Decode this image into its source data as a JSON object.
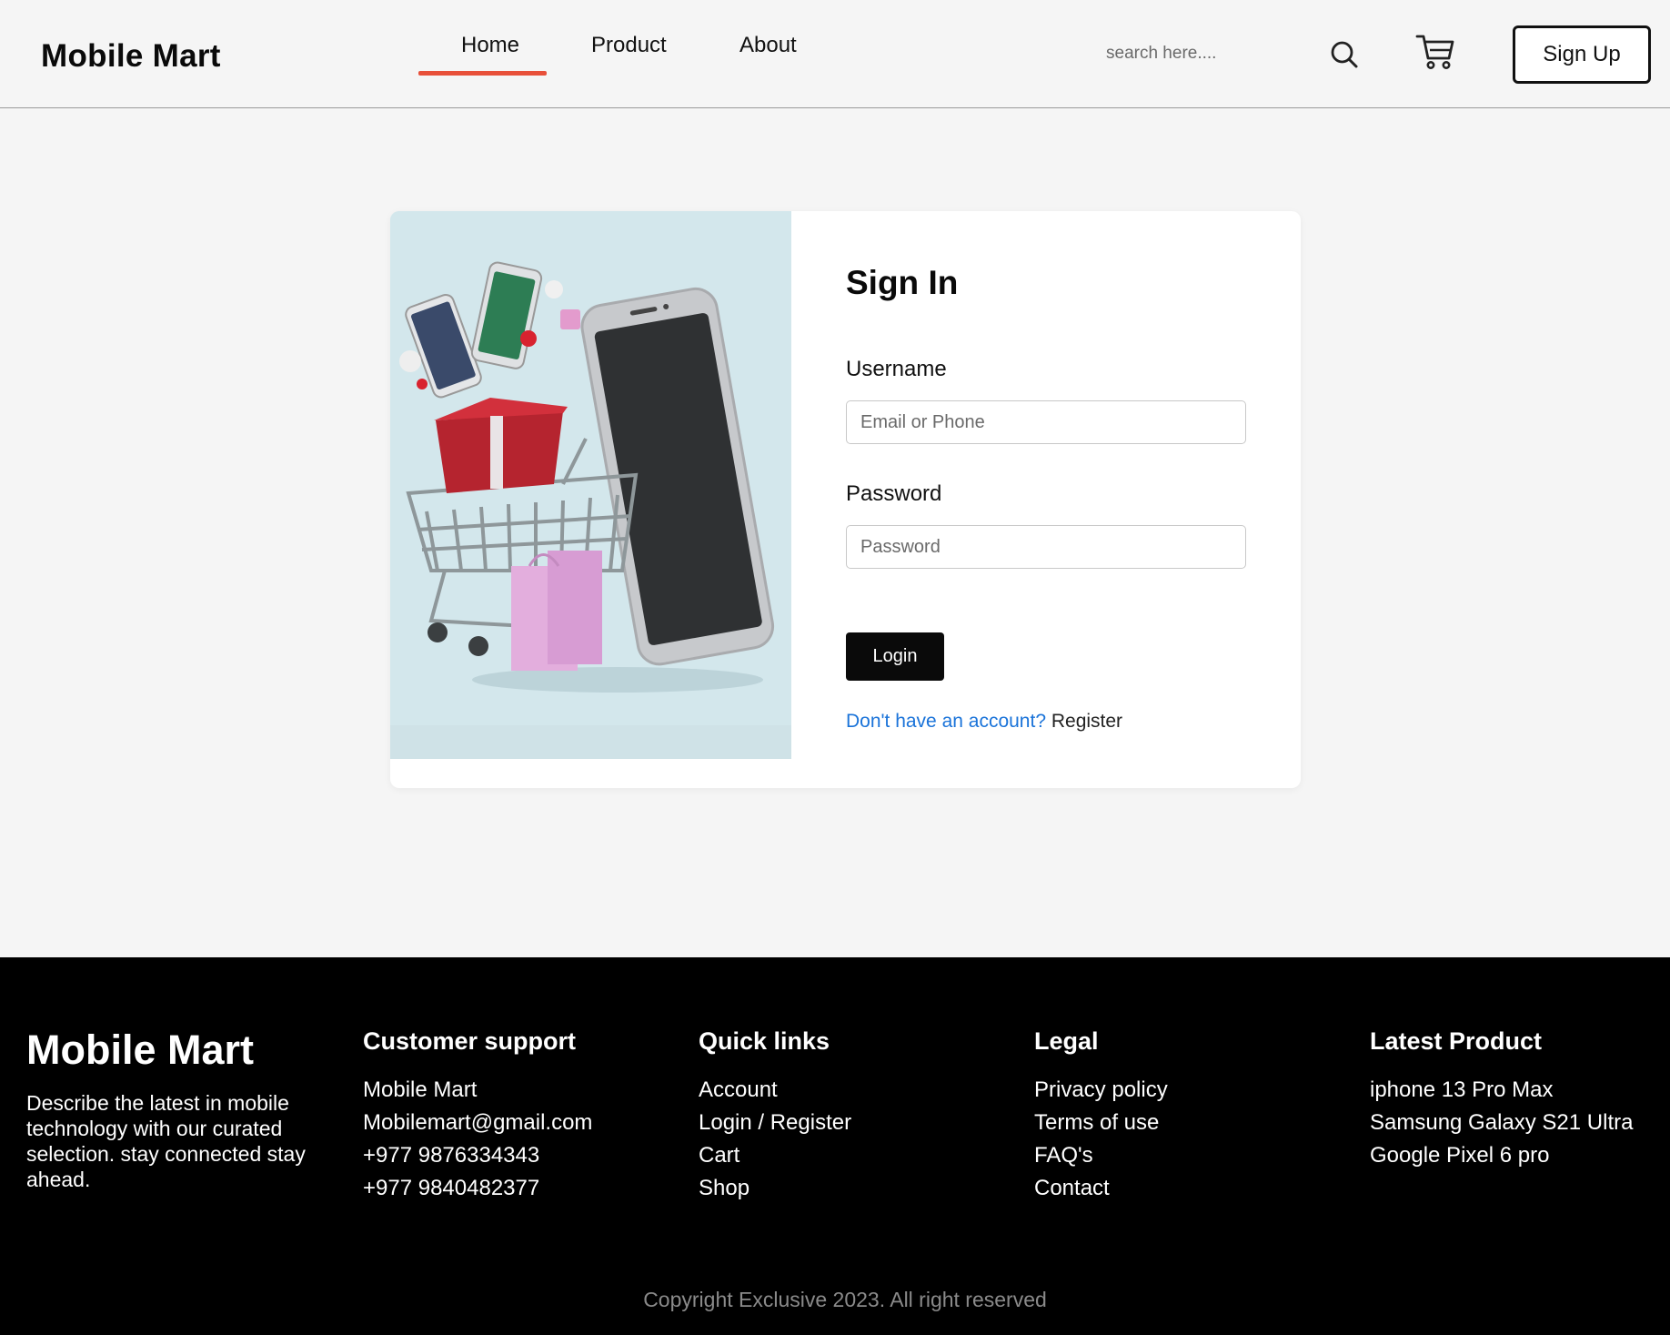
{
  "header": {
    "brand": "Mobile Mart",
    "nav": [
      {
        "label": "Home",
        "active": true
      },
      {
        "label": "Product",
        "active": false
      },
      {
        "label": "About",
        "active": false
      }
    ],
    "search": {
      "placeholder": "search here...."
    },
    "icons": {
      "search": "search-icon",
      "cart": "cart-icon"
    },
    "signup_label": "Sign Up",
    "active_color": "#e8503a"
  },
  "signin": {
    "title": "Sign In",
    "username_label": "Username",
    "username_placeholder": "Email or Phone",
    "password_label": "Password",
    "password_placeholder": "Password",
    "login_label": "Login",
    "register_question": "Don't have an account?",
    "register_link": "Register",
    "link_color": "#1a73d9"
  },
  "footer": {
    "brand": "Mobile Mart",
    "description": "Describe the latest in mobile technology with our curated selection. stay connected stay ahead.",
    "columns": [
      {
        "title": "Customer support",
        "items": [
          "Mobile Mart",
          "Mobilemart@gmail.com",
          "+977 9876334343",
          "+977 9840482377"
        ]
      },
      {
        "title": "Quick links",
        "items": [
          "Account",
          "Login / Register",
          "Cart",
          "Shop"
        ]
      },
      {
        "title": "Legal",
        "items": [
          "Privacy policy",
          "Terms of use",
          "FAQ's",
          "Contact"
        ]
      },
      {
        "title": "Latest Product",
        "items": [
          "iphone 13 Pro Max",
          "Samsung Galaxy S21 Ultra",
          "Google Pixel 6 pro"
        ]
      }
    ],
    "copyright": "Copyright Exclusive 2023. All right reserved"
  }
}
